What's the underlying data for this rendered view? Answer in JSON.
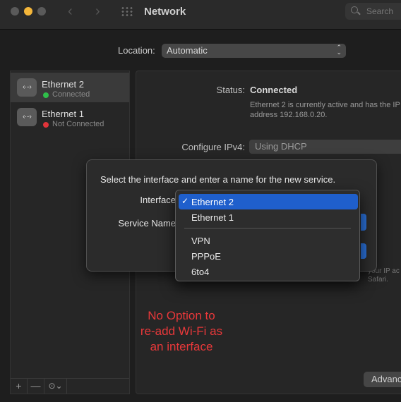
{
  "window": {
    "title": "Network"
  },
  "search": {
    "placeholder": "Search"
  },
  "location": {
    "label": "Location:",
    "value": "Automatic"
  },
  "sidebar": {
    "items": [
      {
        "name": "Ethernet 2",
        "status": "Connected",
        "status_color": "#2fbf4a"
      },
      {
        "name": "Ethernet 1",
        "status": "Not Connected",
        "status_color": "#e0343a"
      }
    ],
    "footer": {
      "add": "+",
      "remove": "—",
      "actions": "⊙⌄"
    }
  },
  "detail": {
    "status_label": "Status:",
    "status_value": "Connected",
    "status_desc": "Ethernet 2 is currently active and has the IP address 192.168.0.20.",
    "ipv4_label": "Configure IPv4:",
    "ipv4_value": "Using DHCP",
    "hint_line1": "your IP ac",
    "hint_line2": "Safari.",
    "advanced_label": "Advanc"
  },
  "dialog": {
    "prompt": "Select the interface and enter a name for the new service.",
    "interface_label": "Interface",
    "service_name_label": "Service Name"
  },
  "menu": {
    "items": [
      {
        "label": "Ethernet 2",
        "checked": "✓"
      },
      {
        "label": "Ethernet 1"
      },
      {
        "label": "VPN"
      },
      {
        "label": "PPPoE"
      },
      {
        "label": "6to4"
      }
    ]
  },
  "annotation": {
    "text_line1": "No Option to",
    "text_line2": "re-add Wi-Fi as",
    "text_line3": "an interface",
    "color": "#e8383a"
  },
  "colors": {
    "accent": "#1f5fcc",
    "window_bg": "#1e1e1e"
  }
}
